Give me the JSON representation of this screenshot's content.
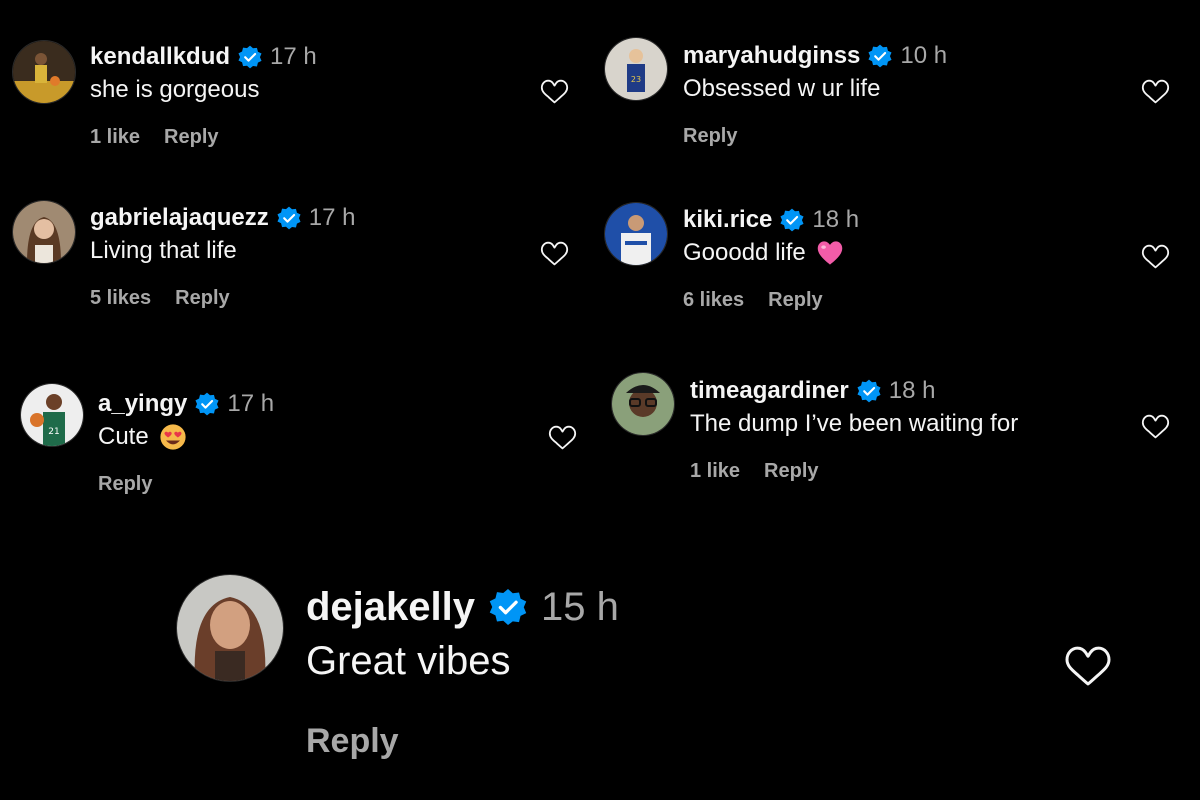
{
  "colors": {
    "background": "#000000",
    "text": "#f5f5f5",
    "secondary": "#a8a8a8",
    "verified": "#0095f6"
  },
  "comments": [
    {
      "username": "kendallkdud",
      "time": "17 h",
      "text": "she is gorgeous",
      "likes": "1 like",
      "reply": "Reply",
      "avatar_icon": "basketball-player-avatar"
    },
    {
      "username": "maryahudginss",
      "time": "10 h",
      "text": "Obsessed w ur life",
      "likes": "",
      "reply": "Reply",
      "avatar_icon": "jersey-player-avatar"
    },
    {
      "username": "gabrielajaquezz",
      "time": "17 h",
      "text": "Living that life",
      "likes": "5 likes",
      "reply": "Reply",
      "avatar_icon": "portrait-avatar"
    },
    {
      "username": "kiki.rice",
      "time": "18 h",
      "text": "Gooodd life",
      "text_emoji": "pink-heart-icon",
      "likes": "6 likes",
      "reply": "Reply",
      "avatar_icon": "team-jersey-avatar"
    },
    {
      "username": "a_yingy",
      "time": "17 h",
      "text": "Cute",
      "text_emoji": "heart-eyes-emoji-icon",
      "likes": "",
      "reply": "Reply",
      "avatar_icon": "green-jersey-avatar"
    },
    {
      "username": "timeagardiner",
      "time": "18 h",
      "text": "The dump I’ve been waiting for",
      "likes": "1 like",
      "reply": "Reply",
      "avatar_icon": "glasses-portrait-avatar"
    },
    {
      "username": "dejakelly",
      "time": "15 h",
      "text": "Great vibes",
      "likes": "",
      "reply": "Reply",
      "avatar_icon": "portrait-avatar"
    }
  ]
}
